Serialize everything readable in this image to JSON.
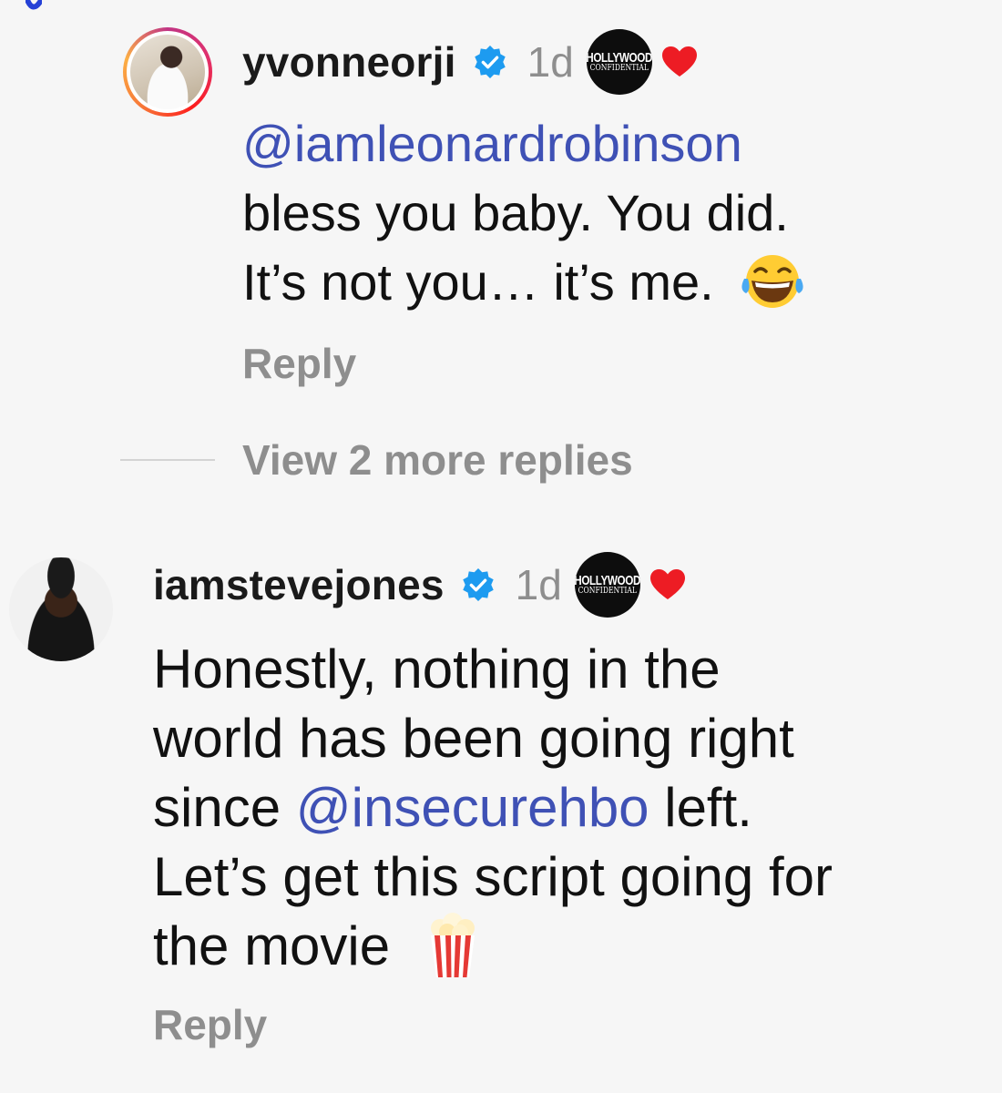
{
  "comments": [
    {
      "username": "yvonneorji",
      "age": "1d",
      "mention": "@iamleonardrobinson",
      "line2": "bless you baby. You did.",
      "line3": "It’s not you… it’s me.",
      "emoji": "face-with-tears-of-joy",
      "reply": "Reply",
      "creator_logo": [
        "HOLLYWOOD",
        "CONFIDENTIAL"
      ],
      "liked_by_creator": true
    },
    {
      "username": "iamstevejones",
      "age": "1d",
      "line1": "Honestly, nothing in the",
      "line2": "world has been going right",
      "line3_prefix": "since ",
      "mention": "@insecurehbo",
      "line3_suffix": " left.",
      "line4": "Let’s get this script going for",
      "line5": "the movie",
      "emoji": "popcorn",
      "reply": "Reply",
      "creator_logo": [
        "HOLLYWOOD",
        "CONFIDENTIAL"
      ],
      "liked_by_creator": true
    }
  ],
  "view_more": "View 2 more replies",
  "colors": {
    "mention": "#3f51b5",
    "muted": "#8e8e8e",
    "verified": "#1d9bf0",
    "heart": "#ed1c24"
  }
}
